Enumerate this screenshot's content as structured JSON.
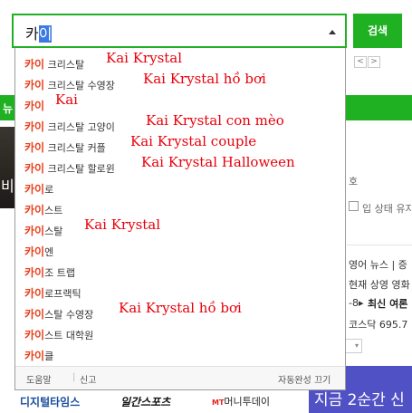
{
  "search": {
    "query_prefix": "카",
    "query_selected": "이",
    "button_label": "검색"
  },
  "suggestions": [
    {
      "keyword": "카이",
      "rest": " 크리스탈",
      "note": "Kai Krystal"
    },
    {
      "keyword": "카이",
      "rest": " 크리스탈 수영장",
      "note": "Kai Krystal hồ bơi"
    },
    {
      "keyword": "카이",
      "rest": "",
      "note": "Kai"
    },
    {
      "keyword": "카이",
      "rest": " 크리스탈 고양이",
      "note": "Kai Krystal con mèo"
    },
    {
      "keyword": "카이",
      "rest": " 크리스탈 커플",
      "note": "Kai Krystal couple"
    },
    {
      "keyword": "카이",
      "rest": " 크리스탈 할로윈",
      "note": "Kai Krystal Halloween"
    },
    {
      "keyword": "카이",
      "rest": "로",
      "note": ""
    },
    {
      "keyword": "카이",
      "rest": "스트",
      "note": ""
    },
    {
      "keyword": "카이",
      "rest": "스탈",
      "note": "Kai Krystal"
    },
    {
      "keyword": "카이",
      "rest": "엔",
      "note": ""
    },
    {
      "keyword": "카이",
      "rest": "조 트랩",
      "note": ""
    },
    {
      "keyword": "카이",
      "rest": "로프랙틱",
      "note": ""
    },
    {
      "keyword": "카이",
      "rest": "스탈 수영장",
      "note": "Kai Krystal hồ bơi"
    },
    {
      "keyword": "카이",
      "rest": "스트 대학원",
      "note": ""
    },
    {
      "keyword": "카이",
      "rest": "클",
      "note": ""
    }
  ],
  "dropdown_footer": {
    "help": "도움말",
    "report": "신고",
    "autocomplete_off": "자동완성 끄기"
  },
  "background": {
    "band_text": "뉴",
    "photo_text": "비",
    "page_prev": "<",
    "page_next": ">",
    "right_texts": [
      "호",
      "입 상태 유지",
      "영어 뉴스 | 증",
      "현재 상영 영화",
      "-8▸",
      "최신 여론",
      "코스닥 695.7"
    ],
    "ad_text": "지금 2순간 신",
    "press": [
      "디지털타임스",
      "일간스포츠",
      "MT",
      "머니투데이"
    ]
  },
  "colors": {
    "brand_green": "#1fb122",
    "keyword_red": "#e8401c",
    "annotation_red": "#e8000b",
    "ad_purple": "#5151c6"
  }
}
